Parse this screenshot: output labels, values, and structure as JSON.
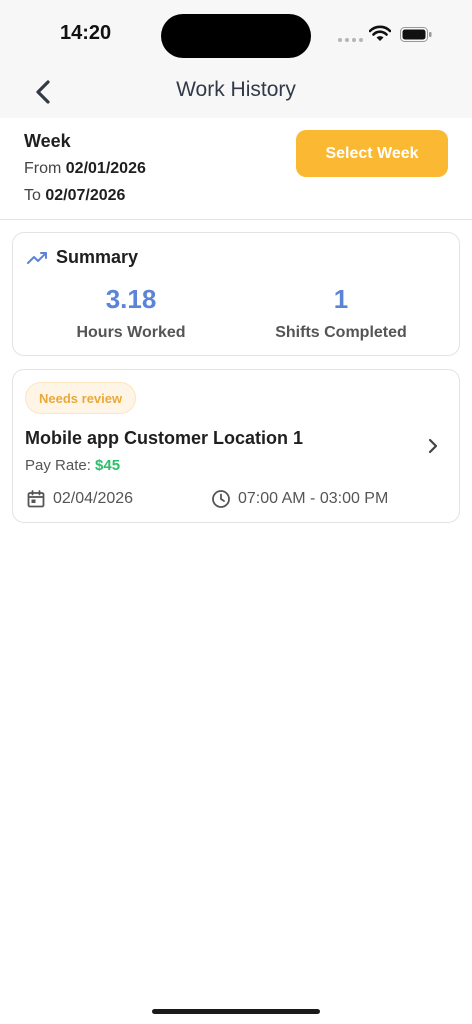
{
  "status_bar": {
    "time": "14:20"
  },
  "nav": {
    "title": "Work History"
  },
  "week": {
    "title": "Week",
    "from_label": "From",
    "from_date": "02/01/2026",
    "to_label": "To",
    "to_date": "02/07/2026",
    "select_button": "Select Week"
  },
  "summary": {
    "title": "Summary",
    "hours_value": "3.18",
    "hours_label": "Hours Worked",
    "shifts_value": "1",
    "shifts_label": "Shifts Completed"
  },
  "shifts": [
    {
      "status": "Needs review",
      "location": "Mobile app Customer Location 1",
      "pay_rate_label": "Pay Rate:",
      "pay_rate_value": "$45",
      "date": "02/04/2026",
      "time_range": "07:00 AM - 03:00 PM"
    }
  ],
  "colors": {
    "accent_orange": "#fbb933",
    "stat_blue": "#5b84d8",
    "pay_green": "#2bbf6a",
    "badge_text": "#e9a93a",
    "badge_bg": "#fff5e6"
  },
  "icons": {
    "back": "chevron-left-icon",
    "summary": "trending-up-icon",
    "shift_open": "chevron-right-icon",
    "date": "calendar-icon",
    "time": "clock-icon",
    "wifi": "wifi-icon",
    "battery": "battery-icon"
  }
}
